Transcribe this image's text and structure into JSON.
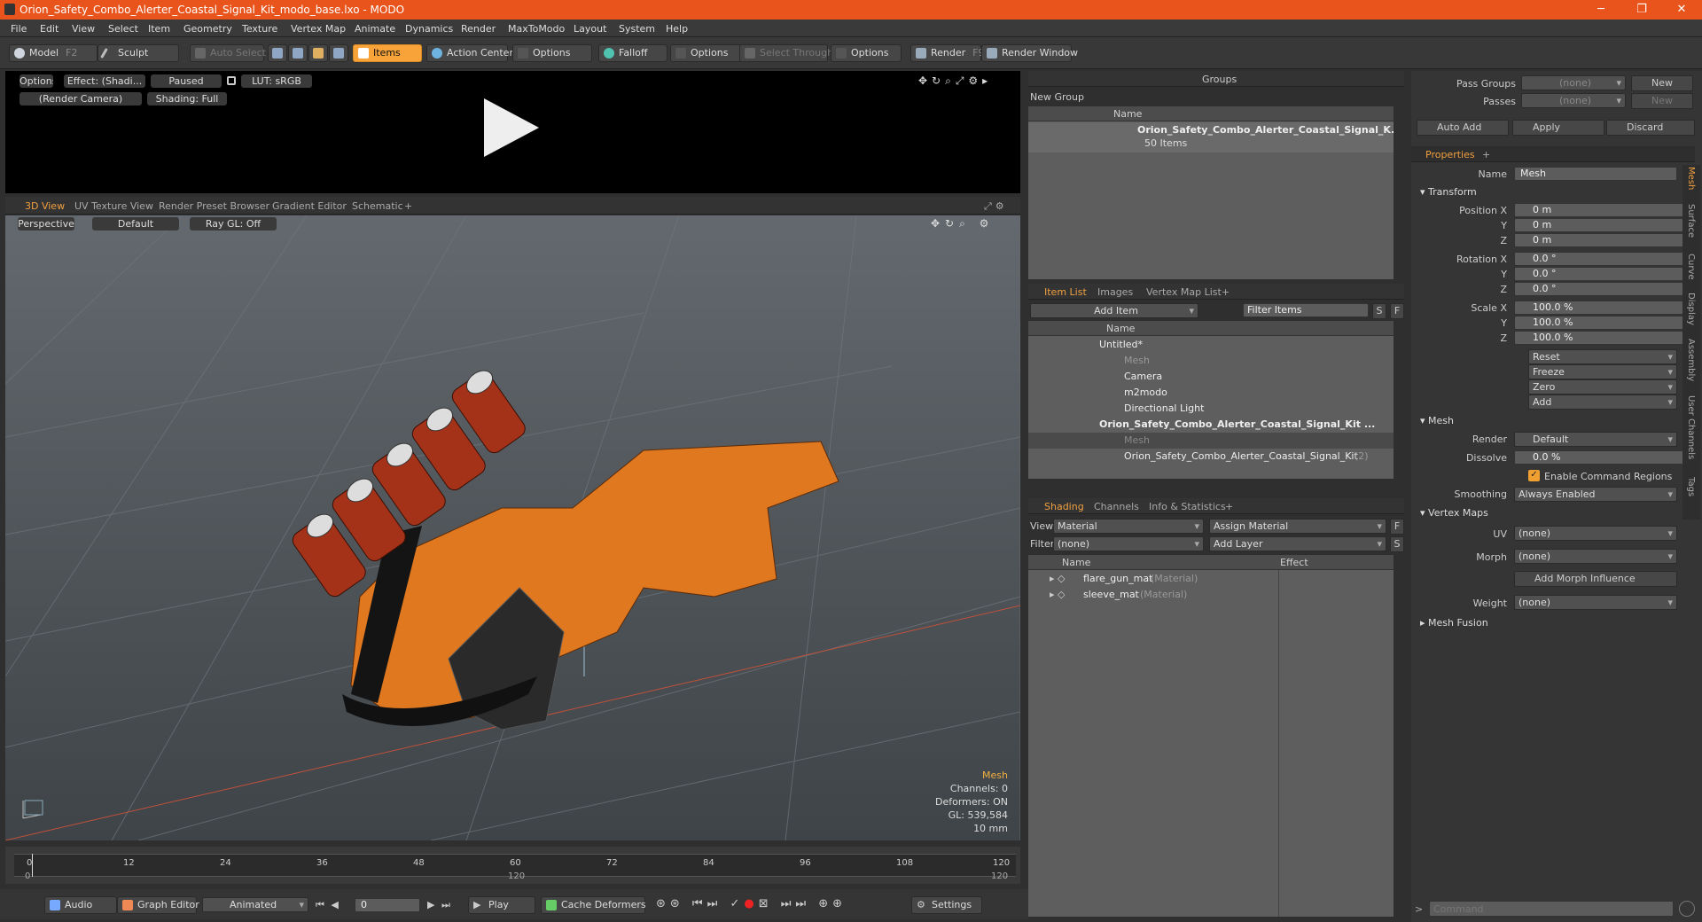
{
  "window": {
    "title": "Orion_Safety_Combo_Alerter_Coastal_Signal_Kit_modo_base.lxo - MODO",
    "minimize": "─",
    "maximize": "❐",
    "close": "✕"
  },
  "menu": [
    "File",
    "Edit",
    "View",
    "Select",
    "Item",
    "Geometry",
    "Texture",
    "Vertex Map",
    "Animate",
    "Dynamics",
    "Render",
    "MaxToModo",
    "Layout",
    "System",
    "Help"
  ],
  "toolbar": {
    "model": "Model",
    "model_key": "F2",
    "sculpt": "Sculpt",
    "auto_select": "Auto Select",
    "items": "Items",
    "action_center": "Action Center",
    "options1": "Options",
    "falloff": "Falloff",
    "options2": "Options",
    "select_through": "Select Through",
    "options3": "Options",
    "render": "Render",
    "render_key": "F9",
    "render_window": "Render Window"
  },
  "render_panel": {
    "options": "Options",
    "effect": "Effect: (Shadi...",
    "paused": "Paused",
    "lut": "LUT: sRGB",
    "camera": "(Render Camera)",
    "shading": "Shading: Full"
  },
  "viewport_tabs": [
    "3D View",
    "UV Texture View",
    "Render Preset Browser",
    "Gradient Editor",
    "Schematic",
    "+"
  ],
  "viewport": {
    "perspective": "Perspective",
    "default": "Default",
    "raygl": "Ray GL: Off",
    "stat_title": "Mesh",
    "channels": "Channels: 0",
    "deformers": "Deformers: ON",
    "gl": "GL: 539,584",
    "scale": "10 mm"
  },
  "timeline": {
    "ticks": [
      "0",
      "12",
      "24",
      "36",
      "48",
      "60",
      "72",
      "84",
      "96",
      "108",
      "120"
    ],
    "sub_ticks": [
      "0",
      "120",
      "120"
    ]
  },
  "bottombar": {
    "audio": "Audio",
    "graph_editor": "Graph Editor",
    "animated": "Animated",
    "frame": "0",
    "play": "Play",
    "cache": "Cache Deformers",
    "settings": "Settings"
  },
  "groups": {
    "title": "Groups",
    "new_group": "New Group",
    "col_name": "Name",
    "item_name": "Orion_Safety_Combo_Alerter_Coastal_Signal_K...",
    "item_count": "50 Items"
  },
  "item_list": {
    "tabs": [
      "Item List",
      "Images",
      "Vertex Map List",
      "+"
    ],
    "add_item": "Add Item",
    "filter": "Filter Items",
    "s": "S",
    "f": "F",
    "col_name": "Name",
    "rows": [
      {
        "name": "Untitled*"
      },
      {
        "name": "Mesh"
      },
      {
        "name": "Camera"
      },
      {
        "name": "m2modo"
      },
      {
        "name": "Directional Light"
      },
      {
        "name": "Orion_Safety_Combo_Alerter_Coastal_Signal_Kit ..."
      },
      {
        "name": "Mesh"
      },
      {
        "name": "Orion_Safety_Combo_Alerter_Coastal_Signal_Kit",
        "count": "(2)"
      }
    ]
  },
  "shading": {
    "tabs": [
      "Shading",
      "Channels",
      "Info & Statistics",
      "+"
    ],
    "view_label": "View",
    "view_value": "Material",
    "assign": "Assign Material",
    "f": "F",
    "filter_label": "Filter",
    "filter_value": "(none)",
    "add_layer": "Add Layer",
    "s": "S",
    "col_name": "Name",
    "col_effect": "Effect",
    "rows": [
      {
        "name": "flare_gun_mat",
        "type": "(Material)"
      },
      {
        "name": "sleeve_mat",
        "type": "(Material)"
      }
    ]
  },
  "passes": {
    "pass_groups": "Pass Groups",
    "pass_value": "(none)",
    "new": "New",
    "passes": "Passes",
    "passes_value": "(none)",
    "new2": "New"
  },
  "actions": {
    "auto_add": "Auto Add",
    "apply": "Apply",
    "discard": "Discard"
  },
  "properties": {
    "tab": "Properties",
    "plus": "+",
    "name_label": "Name",
    "name_value": "Mesh",
    "transform": "Transform",
    "pos_label": "Position X",
    "y": "Y",
    "z": "Z",
    "pos": [
      "0 m",
      "0 m",
      "0 m"
    ],
    "rot_label": "Rotation X",
    "rot": [
      "0.0 °",
      "0.0 °",
      "0.0 °"
    ],
    "scale_label": "Scale X",
    "scale": [
      "100.0 %",
      "100.0 %",
      "100.0 %"
    ],
    "reset": "Reset",
    "freeze": "Freeze",
    "zero": "Zero",
    "add": "Add",
    "mesh": "Mesh",
    "render_label": "Render",
    "render_value": "Default",
    "dissolve_label": "Dissolve",
    "dissolve_value": "0.0 %",
    "enable_cmd": "Enable Command Regions",
    "smoothing_label": "Smoothing",
    "smoothing_value": "Always Enabled",
    "vertex_maps": "Vertex Maps",
    "uv_label": "UV",
    "uv_value": "(none)",
    "morph_label": "Morph",
    "morph_value": "(none)",
    "add_morph": "Add Morph Influence",
    "weight_label": "Weight",
    "weight_value": "(none)",
    "mesh_fusion": "Mesh Fusion",
    "side_tabs": [
      "Mesh",
      "Surface",
      "Curve",
      "Display",
      "Assembly",
      "User Channels",
      "Tags"
    ]
  },
  "command": {
    "placeholder": "Command"
  }
}
